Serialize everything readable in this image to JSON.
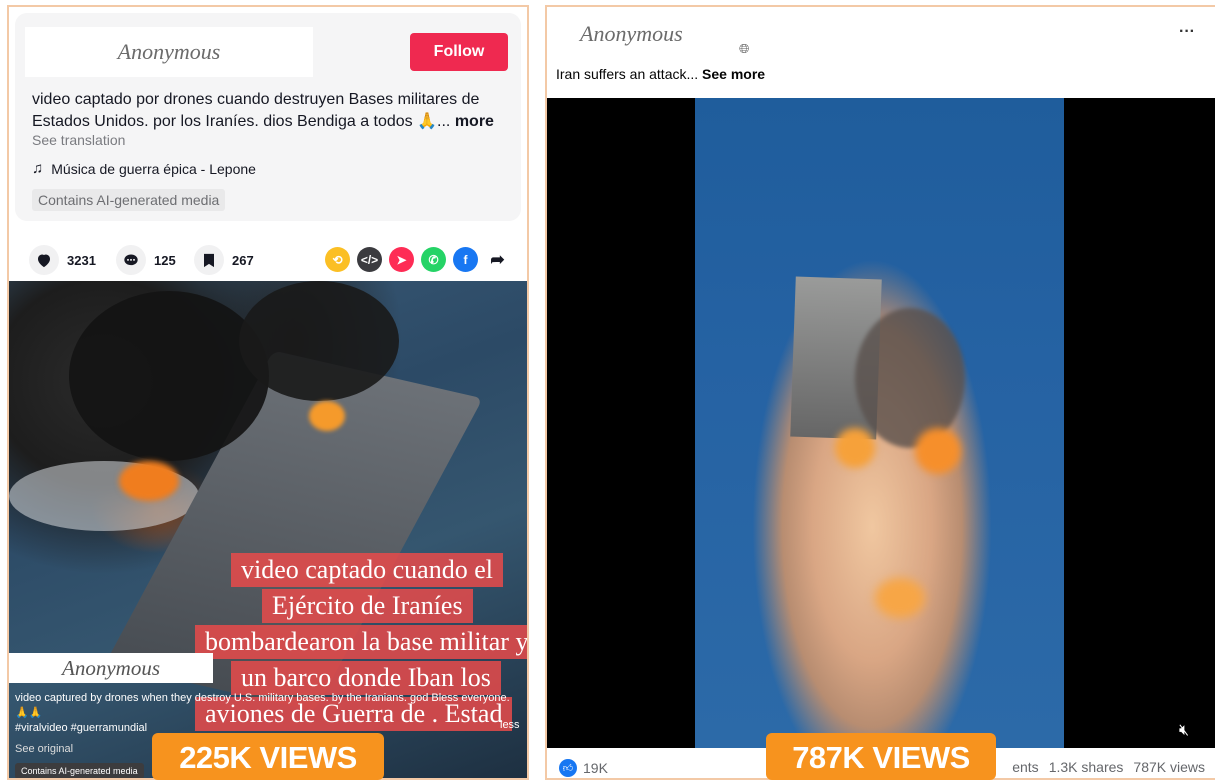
{
  "left_post": {
    "account_name": "Anonymous",
    "follow_label": "Follow",
    "caption": "video captado por drones cuando destruyen Bases militares de Estados Unidos. por los Iraníes. dios Bendiga a todos 🙏...",
    "more_label": "more",
    "see_translation": "See translation",
    "music": "Música de guerra épica - Lepone",
    "ai_tag": "Contains AI-generated media",
    "stats": {
      "likes": "3231",
      "comments": "125",
      "saves": "267"
    },
    "share_icons": [
      "repost-icon",
      "embed-icon",
      "send-icon",
      "whatsapp-icon",
      "facebook-icon",
      "share-arrow-icon"
    ],
    "video": {
      "overlay_lines": [
        "video captado cuando el",
        "Ejército de Iraníes",
        "bombardearon la base militar y",
        "un barco donde Iban los",
        "aviones de Guerra de . Estad"
      ],
      "account_name": "Anonymous",
      "english_caption": "video captured by drones when they destroy U.S. military bases. by the Iranians. god Bless everyone. 🙏🙏",
      "hashtags": "#viralvideo #guerramundial",
      "less_label": "less",
      "see_original": "See original",
      "ai_tag": "Contains AI-generated media"
    },
    "views_badge": "225K VIEWS"
  },
  "right_post": {
    "account_name": "Anonymous",
    "caption": "Iran suffers an attack...",
    "see_more_label": "See more",
    "reactions_count": "19K",
    "comments_fragment": "ents",
    "shares": "1.3K shares",
    "views": "787K views",
    "views_badge": "787K VIEWS"
  },
  "colors": {
    "follow_red": "#ef2950",
    "badge_orange": "#f7931e",
    "facebook_blue": "#1877f2",
    "panel_border": "#f3c9a6"
  }
}
